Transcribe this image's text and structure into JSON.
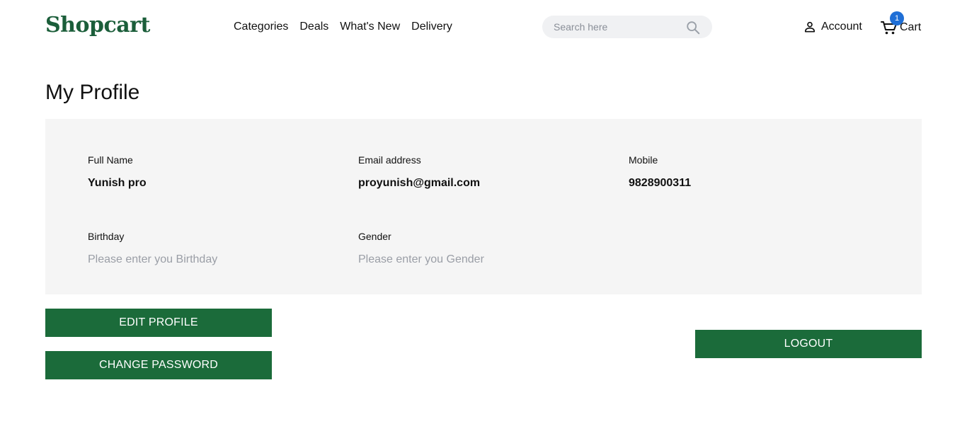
{
  "header": {
    "logo": "Shopcart",
    "nav": [
      {
        "label": "Categories"
      },
      {
        "label": "Deals"
      },
      {
        "label": "What's New"
      },
      {
        "label": "Delivery"
      }
    ],
    "search": {
      "placeholder": "Search here",
      "icon": "search-icon"
    },
    "account": {
      "label": "Account",
      "icon": "person-icon"
    },
    "cart": {
      "label": "Cart",
      "count": "1",
      "icon": "cart-icon",
      "badge_color": "#1f6fd6"
    }
  },
  "page": {
    "title": "My Profile"
  },
  "profile": {
    "full_name": {
      "label": "Full Name",
      "value": "Yunish pro"
    },
    "email": {
      "label": "Email address",
      "value": "proyunish@gmail.com"
    },
    "mobile": {
      "label": "Mobile",
      "value": "9828900311"
    },
    "birthday": {
      "label": "Birthday",
      "placeholder": "Please enter you Birthday"
    },
    "gender": {
      "label": "Gender",
      "placeholder": "Please enter you Gender"
    }
  },
  "actions": {
    "edit_profile": "EDIT PROFILE",
    "change_password": "CHANGE PASSWORD",
    "logout": "LOGOUT"
  },
  "colors": {
    "brand": "#1b5e3a",
    "button": "#1b6b3a",
    "panel_bg": "#f5f5f5",
    "placeholder_text": "#9a9ea6"
  }
}
